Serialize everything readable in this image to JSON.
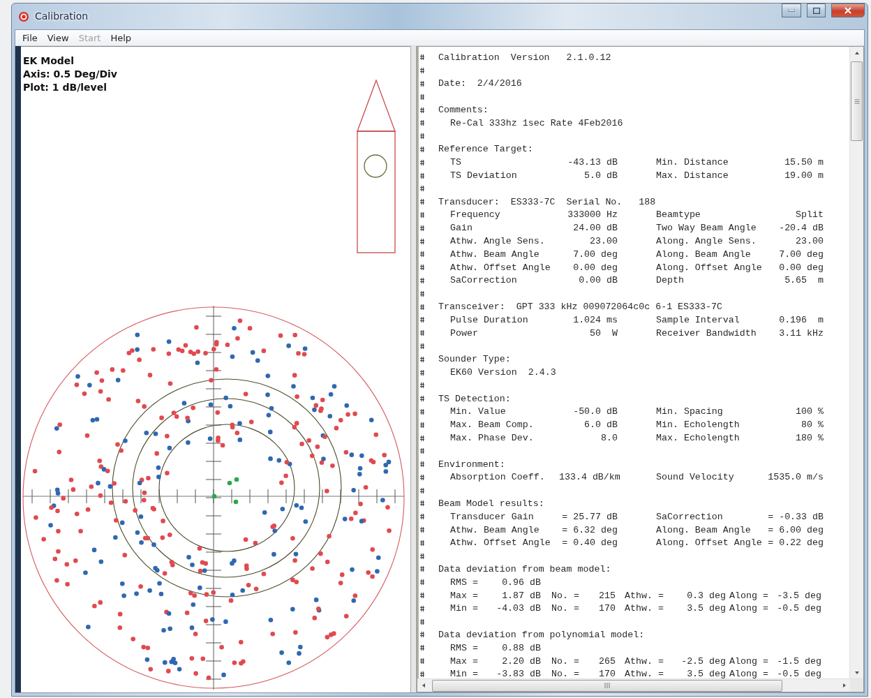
{
  "window": {
    "title": "Calibration"
  },
  "menu": [
    {
      "label": "File",
      "disabled": false
    },
    {
      "label": "View",
      "disabled": false
    },
    {
      "label": "Start",
      "disabled": true
    },
    {
      "label": "Help",
      "disabled": false
    }
  ],
  "plot_info": [
    "EK Model",
    "Axis: 0.5 Deg/Div",
    "Plot: 1 dB/level"
  ],
  "report": [
    {
      "kind": "heading",
      "text": "Calibration  Version   2.1.0.12"
    },
    {
      "kind": "blank"
    },
    {
      "kind": "heading",
      "text": "Date:  2/4/2016"
    },
    {
      "kind": "blank"
    },
    {
      "kind": "heading",
      "text": "Comments:"
    },
    {
      "kind": "text",
      "text": "Re-Cal 333hz 1sec Rate 4Feb2016"
    },
    {
      "kind": "blank"
    },
    {
      "kind": "heading",
      "text": "Reference Target:"
    },
    {
      "kind": "pair",
      "cells": [
        "TS",
        "-43.13 dB",
        "Min. Distance",
        "15.50 m"
      ]
    },
    {
      "kind": "pair",
      "cells": [
        "TS Deviation",
        "5.0 dB",
        "Max. Distance",
        "19.00 m"
      ]
    },
    {
      "kind": "blank"
    },
    {
      "kind": "heading",
      "text": "Transducer:  ES333-7C  Serial No.   188"
    },
    {
      "kind": "pair",
      "cells": [
        "Frequency",
        "333000 Hz",
        "Beamtype",
        "Split"
      ]
    },
    {
      "kind": "pair",
      "cells": [
        "Gain",
        "24.00 dB",
        "Two Way Beam Angle",
        "-20.4 dB"
      ]
    },
    {
      "kind": "pair",
      "cells": [
        "Athw. Angle Sens.",
        "23.00",
        "Along. Angle Sens.",
        "23.00"
      ]
    },
    {
      "kind": "pair",
      "cells": [
        "Athw. Beam Angle",
        "7.00 deg",
        "Along. Beam Angle",
        "7.00 deg"
      ]
    },
    {
      "kind": "pair",
      "cells": [
        "Athw. Offset Angle",
        "0.00 deg",
        "Along. Offset Angle",
        "0.00 deg"
      ]
    },
    {
      "kind": "pair",
      "cells": [
        "SaCorrection",
        "0.00 dB",
        "Depth",
        "5.65  m"
      ]
    },
    {
      "kind": "blank"
    },
    {
      "kind": "heading",
      "text": "Transceiver:  GPT 333 kHz 009072064c0c 6-1 ES333-7C"
    },
    {
      "kind": "pair",
      "cells": [
        "Pulse Duration",
        "1.024 ms",
        "Sample Interval",
        "0.196  m"
      ]
    },
    {
      "kind": "pair",
      "cells": [
        "Power",
        "50  W",
        "Receiver Bandwidth",
        "3.11 kHz"
      ]
    },
    {
      "kind": "blank"
    },
    {
      "kind": "heading",
      "text": "Sounder Type:"
    },
    {
      "kind": "text",
      "text": "EK60 Version  2.4.3"
    },
    {
      "kind": "blank"
    },
    {
      "kind": "heading",
      "text": "TS Detection:"
    },
    {
      "kind": "pair",
      "cells": [
        "Min. Value",
        "-50.0 dB",
        "Min. Spacing",
        "100 %"
      ]
    },
    {
      "kind": "pair",
      "cells": [
        "Max. Beam Comp.",
        "6.0 dB",
        "Min. Echolength",
        "80 %"
      ]
    },
    {
      "kind": "pair",
      "cells": [
        "Max. Phase Dev.",
        "8.0",
        "Max. Echolength",
        "180 %"
      ]
    },
    {
      "kind": "blank"
    },
    {
      "kind": "heading",
      "text": "Environment:"
    },
    {
      "kind": "pair",
      "cells": [
        "Absorption Coeff.",
        "133.4 dB/km",
        "Sound Velocity",
        "1535.0 m/s"
      ]
    },
    {
      "kind": "blank"
    },
    {
      "kind": "heading",
      "text": "Beam Model results:"
    },
    {
      "kind": "pair",
      "cells": [
        "Transducer Gain",
        "= 25.77 dB",
        "SaCorrection",
        "= -0.33 dB"
      ]
    },
    {
      "kind": "pair",
      "cells": [
        "Athw. Beam Angle",
        "= 6.32 deg",
        "Along. Beam Angle",
        "= 6.00 deg"
      ]
    },
    {
      "kind": "pair",
      "cells": [
        "Athw. Offset Angle",
        "= 0.40 deg",
        "Along. Offset Angle",
        "= 0.22 deg"
      ]
    },
    {
      "kind": "blank"
    },
    {
      "kind": "heading",
      "text": "Data deviation from beam model:"
    },
    {
      "kind": "dev",
      "cells": [
        "RMS =",
        "0.96 dB"
      ]
    },
    {
      "kind": "dev",
      "cells": [
        "Max =",
        "1.87 dB",
        "No. =",
        "215",
        "Athw. =",
        "0.3 deg",
        "Along =",
        "-3.5 deg"
      ]
    },
    {
      "kind": "dev",
      "cells": [
        "Min =",
        "-4.03 dB",
        "No. =",
        "170",
        "Athw. =",
        "3.5 deg",
        "Along =",
        "-0.5 deg"
      ]
    },
    {
      "kind": "blank"
    },
    {
      "kind": "heading",
      "text": "Data deviation from polynomial model:"
    },
    {
      "kind": "dev",
      "cells": [
        "RMS =",
        "0.88 dB"
      ]
    },
    {
      "kind": "dev",
      "cells": [
        "Max =",
        "2.20 dB",
        "No. =",
        "265",
        "Athw. =",
        "-2.5 deg",
        "Along =",
        "-1.5 deg"
      ]
    },
    {
      "kind": "dev",
      "cells": [
        "Min =",
        "-3.83 dB",
        "No. =",
        "170",
        "Athw. =",
        "3.5 deg",
        "Along =",
        "-0.5 deg"
      ]
    }
  ]
}
